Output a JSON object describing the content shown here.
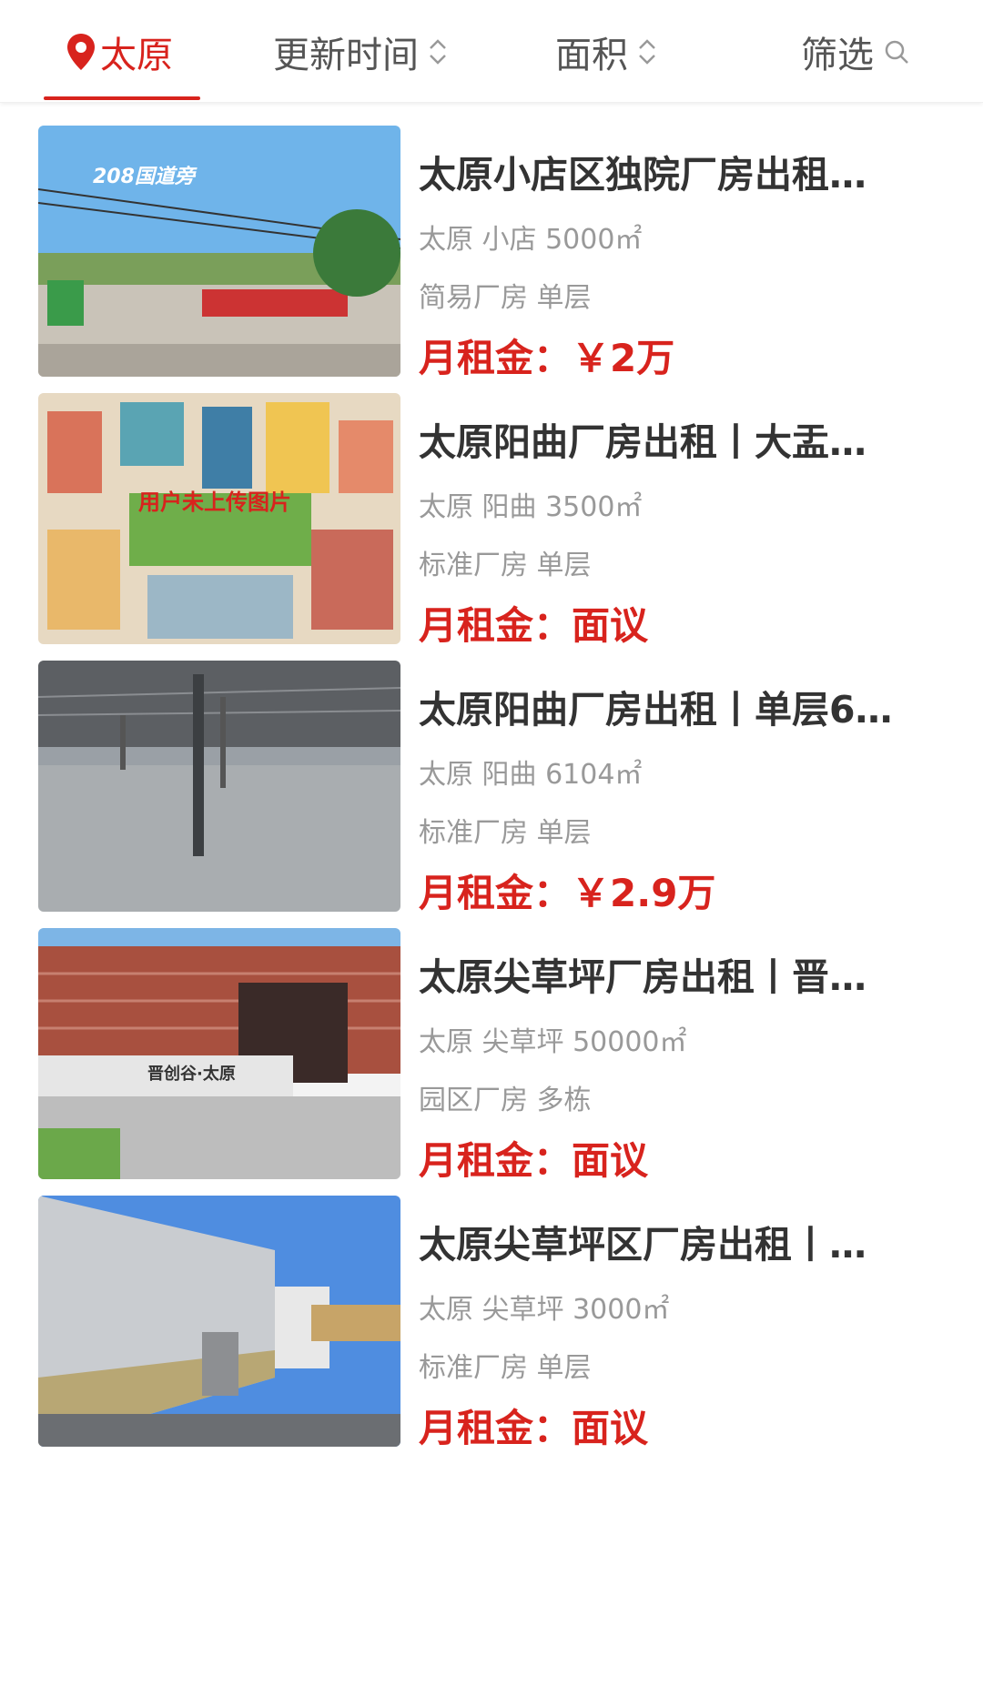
{
  "colors": {
    "accent": "#d8231d",
    "title_text": "#333333",
    "meta_text": "#999999"
  },
  "tabs": {
    "city": {
      "label": "太原",
      "icon": "location-pin-icon"
    },
    "update_time": {
      "label": "更新时间",
      "icon": "sort-icon"
    },
    "area": {
      "label": "面积",
      "icon": "sort-icon"
    },
    "filter": {
      "label": "筛选",
      "icon": "search-icon"
    }
  },
  "listings": [
    {
      "title": "太原小店区独院厂房出租…",
      "location": "太原 小店 5000㎡",
      "type": "简易厂房 单层",
      "price_label": "月租金：",
      "price_value": "￥2万",
      "image_caption": "208国道旁"
    },
    {
      "title": "太原阳曲厂房出租丨大盂…",
      "location": "太原 阳曲 3500㎡",
      "type": "标准厂房 单层",
      "price_label": "月租金：",
      "price_value": "面议",
      "image_caption": "用户未上传图片"
    },
    {
      "title": "太原阳曲厂房出租丨单层6…",
      "location": "太原 阳曲 6104㎡",
      "type": "标准厂房 单层",
      "price_label": "月租金：",
      "price_value": "￥2.9万"
    },
    {
      "title": "太原尖草坪厂房出租丨晋…",
      "location": "太原 尖草坪 50000㎡",
      "type": "园区厂房 多栋",
      "price_label": "月租金：",
      "price_value": "面议",
      "image_caption": "晋创谷·太原"
    },
    {
      "title": "太原尖草坪区厂房出租丨…",
      "location": "太原 尖草坪 3000㎡",
      "type": "标准厂房 单层",
      "price_label": "月租金：",
      "price_value": "面议"
    }
  ]
}
